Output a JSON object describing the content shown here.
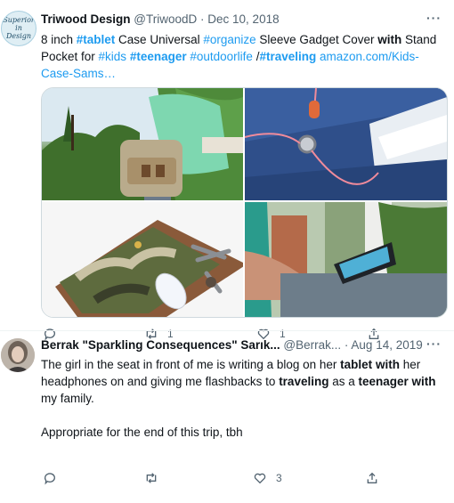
{
  "tweet1": {
    "display_name": "Triwood Design",
    "handle": "@TriwoodD",
    "sep": "·",
    "date": "Dec 10, 2018",
    "more": "···",
    "avatar_text_lines": [
      "Superior",
      "in",
      "Design"
    ],
    "text": {
      "p1": "8 inch ",
      "tag_tablet": "#tablet",
      "p2": " Case Universal ",
      "tag_organize": "#organize",
      "p3": " Sleeve Gadget Cover ",
      "kw_with": "with",
      "p4": " Stand Pocket for ",
      "tag_kids": "#kids",
      "p5": " ",
      "tag_teenager": "#teenager",
      "p6": " ",
      "tag_outdoorlife": "#outdoorlife",
      "p7": " /",
      "tag_traveling": "#traveling",
      "p8": " ",
      "link": "amazon.com/Kids-Case-Sams…"
    },
    "actions": {
      "reply": "",
      "retweet": "1",
      "like": "1",
      "share": ""
    }
  },
  "tweet2": {
    "display_name": "Berrak \"Sparkling Consequences\" Sarık...",
    "handle": "@Berrak...",
    "sep": "·",
    "date": "Aug 14, 2019",
    "more": "···",
    "text": {
      "p1": "The girl in the seat in front of me is writing a blog on her ",
      "kw_tablet": "tablet",
      "p2": " ",
      "kw_with1": "with",
      "p3": " her headphones on and giving me flashbacks to ",
      "kw_traveling": "traveling",
      "p4": " as a ",
      "kw_teenager": "teenager",
      "p5": " ",
      "kw_with2": "with",
      "p6": " my family.",
      "p7": "Appropriate for the end of this trip, tbh"
    },
    "actions": {
      "reply": "",
      "retweet": "",
      "like": "3",
      "share": ""
    }
  },
  "colors": {
    "accent": "#1d9bf0",
    "text": "#0f1419",
    "muted": "#536471",
    "border": "#cfd9de"
  }
}
